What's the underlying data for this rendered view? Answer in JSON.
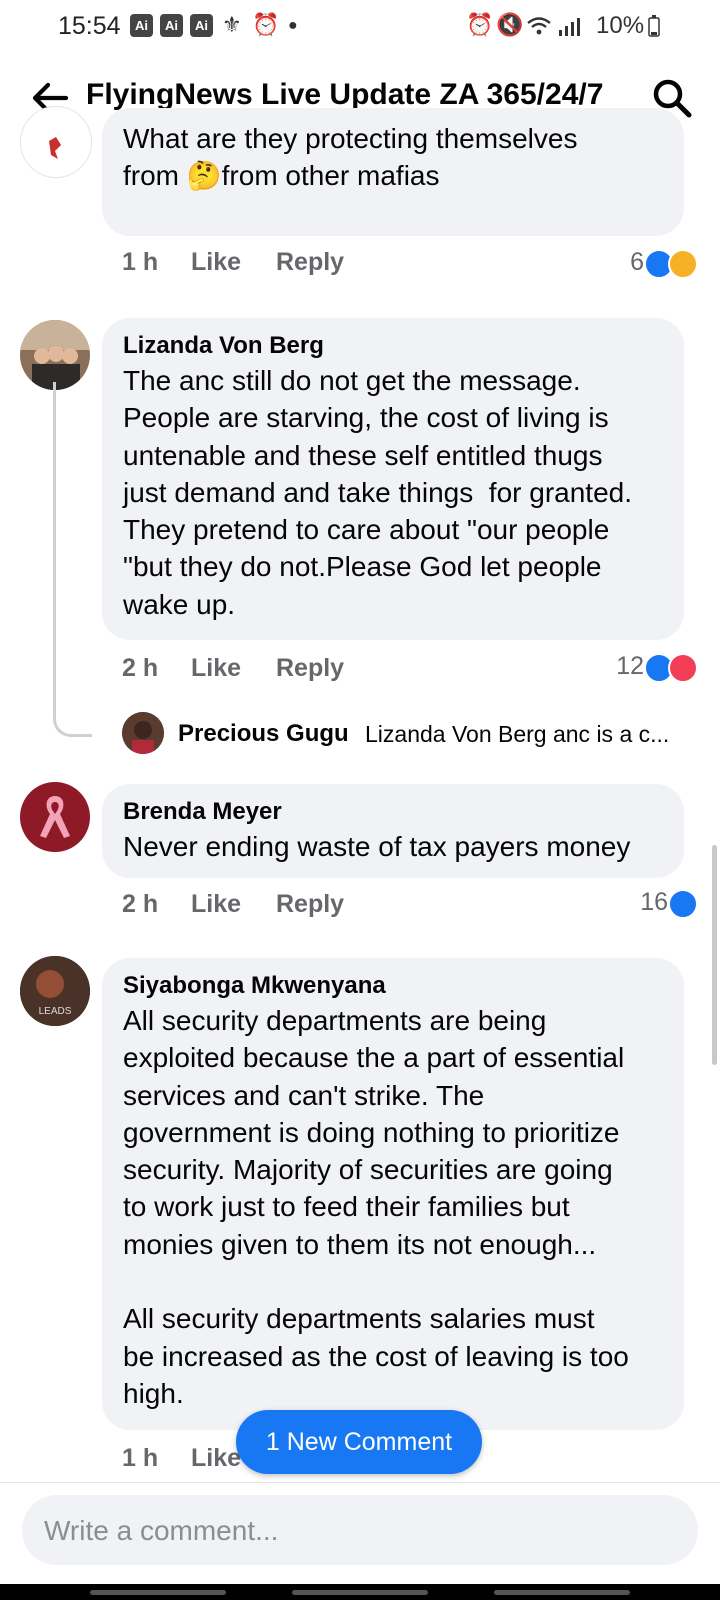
{
  "status_bar": {
    "time": "15:54",
    "ai_badges": [
      "Ai",
      "Ai",
      "Ai"
    ],
    "battery": "10%"
  },
  "header": {
    "title": "FlyingNews Live Update ZA 365/24/7"
  },
  "comments": [
    {
      "author": "",
      "text": "What are they protecting themselves\nfrom 🤔from other mafias",
      "time": "1 h",
      "like_label": "Like",
      "reply_label": "Reply",
      "reaction_count": "6",
      "reactions": [
        "like-icon",
        "haha-icon"
      ]
    },
    {
      "author": "Lizanda Von Berg",
      "text": "The anc still do not get the message.\nPeople are starving, the cost of living is\nuntenable and these self entitled thugs\njust demand and take things  for granted.\nThey pretend to care about \"our people\n\"but they do not.Please God let people\nwake up.",
      "time": "2 h",
      "like_label": "Like",
      "reply_label": "Reply",
      "reaction_count": "12",
      "reactions": [
        "like-icon",
        "love-icon"
      ],
      "reply_preview": {
        "author": "Precious Gugu",
        "text": "Lizanda Von Berg anc is a c..."
      }
    },
    {
      "author": "Brenda Meyer",
      "text": "Never ending waste of tax payers money",
      "time": "2 h",
      "like_label": "Like",
      "reply_label": "Reply",
      "reaction_count": "16",
      "reactions": [
        "like-icon"
      ]
    },
    {
      "author": "Siyabonga Mkwenyana",
      "text": "All security departments are being\nexploited because the a part of essential\nservices and can't strike. The\ngovernment is doing nothing to prioritize\nsecurity. Majority of securities are going\nto work just to feed their families but\nmonies given to them its not enough...\n\nAll security departments salaries must\nbe increased as the cost of leaving is too\nhigh.",
      "time": "1 h",
      "like_label": "Like",
      "avatar_text": "LEADS"
    }
  ],
  "new_comment_button": "1 New Comment",
  "composer": {
    "placeholder": "Write a comment..."
  },
  "colors": {
    "accent": "#1877f2",
    "bubble": "#f0f2f5",
    "meta": "#65676b",
    "love": "#f33e58",
    "haha": "#f7b125"
  }
}
